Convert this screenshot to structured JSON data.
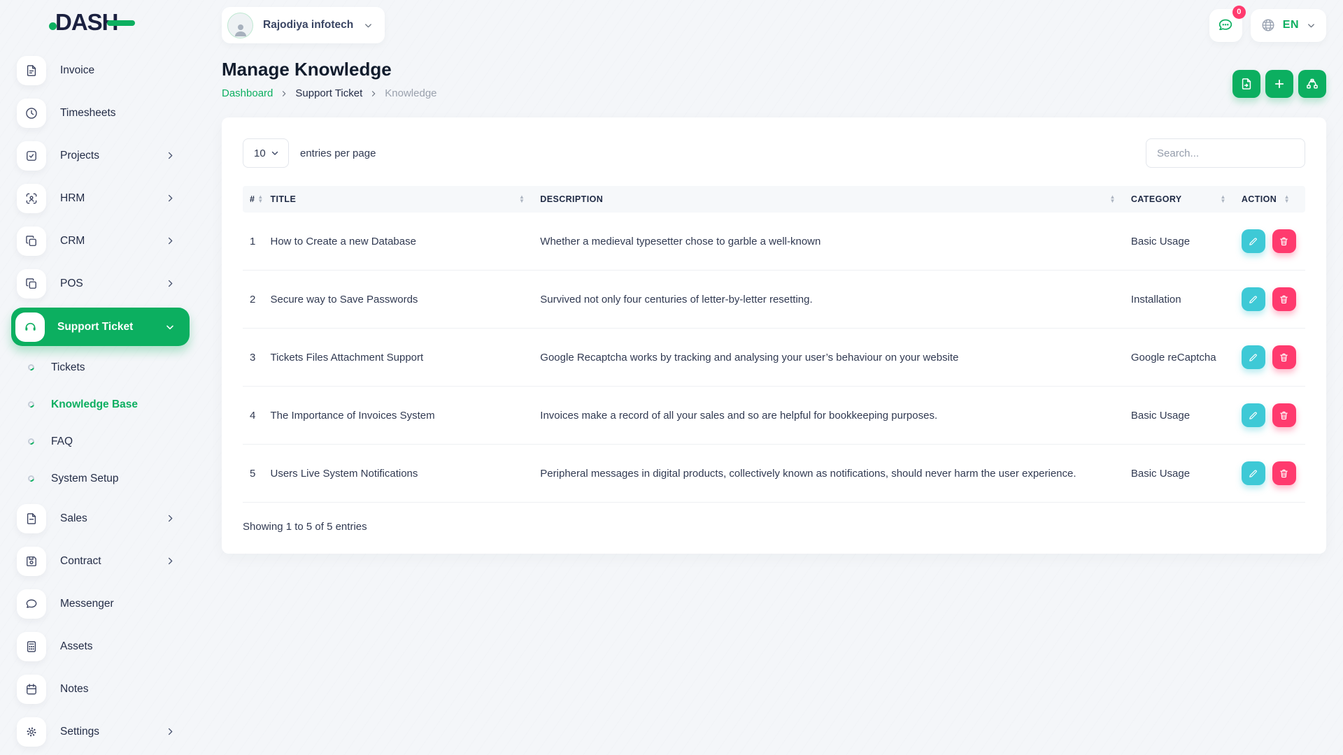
{
  "brand": {
    "name": "DASH"
  },
  "topbar": {
    "company_name": "Rajodiya infotech",
    "messages_badge": "0",
    "language": "EN"
  },
  "page": {
    "title": "Manage Knowledge",
    "breadcrumb": {
      "dashboard": "Dashboard",
      "section": "Support Ticket",
      "current": "Knowledge"
    }
  },
  "sidebar": {
    "items": [
      {
        "label": "Invoice"
      },
      {
        "label": "Timesheets"
      },
      {
        "label": "Projects"
      },
      {
        "label": "HRM"
      },
      {
        "label": "CRM"
      },
      {
        "label": "POS"
      },
      {
        "label": "Support Ticket"
      },
      {
        "label": "Tickets"
      },
      {
        "label": "Knowledge Base"
      },
      {
        "label": "FAQ"
      },
      {
        "label": "System Setup"
      },
      {
        "label": "Sales"
      },
      {
        "label": "Contract"
      },
      {
        "label": "Messenger"
      },
      {
        "label": "Assets"
      },
      {
        "label": "Notes"
      },
      {
        "label": "Settings"
      }
    ]
  },
  "table": {
    "entries_per_page": "10",
    "entries_label": "entries per page",
    "search_placeholder": "Search...",
    "columns": {
      "num": "#",
      "title": "TITLE",
      "description": "DESCRIPTION",
      "category": "CATEGORY",
      "action": "ACTION"
    },
    "rows": [
      {
        "num": "1",
        "title": "How to Create a new Database",
        "description": "Whether a medieval typesetter chose to garble a well-known",
        "category": "Basic Usage"
      },
      {
        "num": "2",
        "title": "Secure way to Save Passwords",
        "description": "Survived not only four centuries of letter-by-letter resetting.",
        "category": "Installation"
      },
      {
        "num": "3",
        "title": "Tickets Files Attachment Support",
        "description": "Google Recaptcha works by tracking and analysing your user’s behaviour on your website",
        "category": "Google reCaptcha"
      },
      {
        "num": "4",
        "title": "The Importance of Invoices System",
        "description": "Invoices make a record of all your sales and so are helpful for bookkeeping purposes.",
        "category": "Basic Usage"
      },
      {
        "num": "5",
        "title": "Users Live System Notifications",
        "description": "Peripheral messages in digital products, collectively known as notifications, should never harm the user experience.",
        "category": "Basic Usage"
      }
    ],
    "footer": "Showing 1 to 5 of 5 entries"
  },
  "colors": {
    "primary": "#0caf60",
    "info": "#3ec9d6",
    "danger": "#ff3a6e"
  }
}
